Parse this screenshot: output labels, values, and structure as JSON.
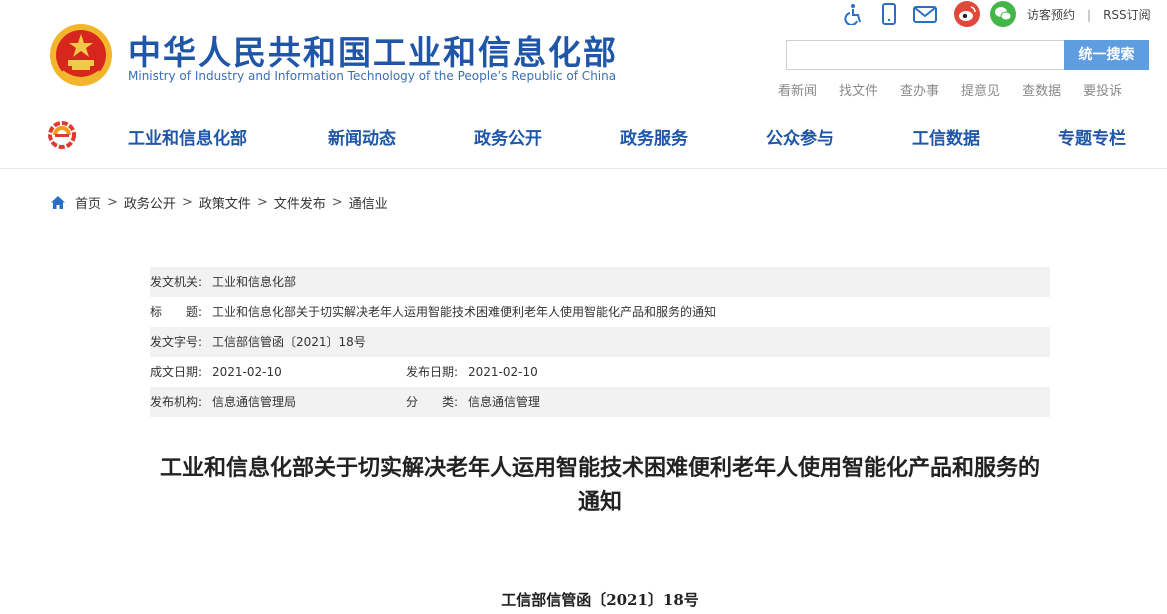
{
  "header": {
    "title": "中华人民共和国工业和信息化部",
    "subtitle": "Ministry of Industry and Information Technology of the People’s Republic of China",
    "top_icons": [
      "accessibility-icon",
      "mobile-icon",
      "mail-icon",
      "weibo-icon",
      "wechat-icon"
    ],
    "top_links": [
      "访客预约",
      "RSS订阅"
    ],
    "search": {
      "placeholder": "",
      "button_label": "统一搜索"
    },
    "quick_links": [
      "看新闻",
      "找文件",
      "查办事",
      "提意见",
      "查数据",
      "要投诉"
    ]
  },
  "nav": {
    "items": [
      "工业和信息化部",
      "新闻动态",
      "政务公开",
      "政务服务",
      "公众参与",
      "工信数据",
      "专题专栏"
    ]
  },
  "breadcrumb": [
    "首页",
    "政务公开",
    "政策文件",
    "文件发布",
    "通信业"
  ],
  "info": {
    "issuer_label": "发文机关:",
    "issuer": "工业和信息化部",
    "subject_label": "标　　题:",
    "subject": "工业和信息化部关于切实解决老年人运用智能技术困难便利老年人使用智能化产品和服务的通知",
    "doc_no_label": "发文字号:",
    "doc_no": "工信部信管函〔2021〕18号",
    "created_label": "成文日期:",
    "created": "2021-02-10",
    "published_label": "发布日期:",
    "published": "2021-02-10",
    "org_label": "发布机构:",
    "org": "信息通信管理局",
    "category_label": "分　　类:",
    "category": "信息通信管理"
  },
  "document": {
    "title": "工业和信息化部关于切实解决老年人运用智能技术困难便利老年人使用智能化产品和服务的通知",
    "number": "工信部信管函〔2021〕18号"
  },
  "colors": {
    "brand_blue": "#1f56a8",
    "search_button": "#5d9de0",
    "accent_red": "#e03a2f"
  }
}
